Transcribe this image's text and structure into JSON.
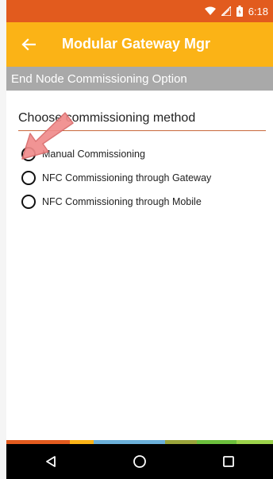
{
  "status_bar": {
    "time": "6:18",
    "icons": [
      "wifi-icon",
      "signal-icon",
      "battery-icon"
    ]
  },
  "app_bar": {
    "title": "Modular Gateway Mgr",
    "back_icon": "arrow-left-icon",
    "color": "#fbb316"
  },
  "section": {
    "title": "End Node Commissioning Option"
  },
  "form": {
    "prompt": "Choose commissioning method",
    "options": [
      {
        "label": "Manual Commissioning",
        "selected": false
      },
      {
        "label": "NFC Commissioning through Gateway",
        "selected": false
      },
      {
        "label": "NFC Commissioning through Mobile",
        "selected": false
      }
    ]
  },
  "nav_bar": {
    "buttons": [
      "back-triangle-icon",
      "home-circle-icon",
      "recents-square-icon"
    ]
  },
  "colors": {
    "status_bar": "#e25b1e",
    "section_header": "#a9a9a9",
    "annotation_arrow": "#f08b8b"
  }
}
